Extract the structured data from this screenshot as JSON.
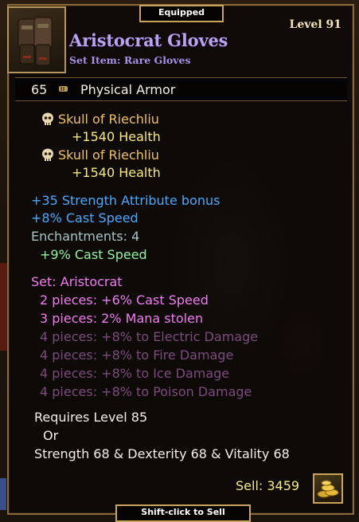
{
  "header": {
    "equipped_tab": "Equipped",
    "level": "Level 91",
    "item_name": "Aristocrat Gloves",
    "item_type": "Set Item: Rare Gloves",
    "item_icon": "gloves-icon"
  },
  "armor": {
    "value": "65",
    "label": "Physical Armor",
    "icon": "armor-fist-icon"
  },
  "sockets": [
    {
      "name": "Skull of Riechliu",
      "bonus": "+1540 Health",
      "icon": "skull-icon"
    },
    {
      "name": "Skull of Riechliu",
      "bonus": "+1540 Health",
      "icon": "skull-icon"
    }
  ],
  "attributes": [
    "+35 Strength Attribute bonus",
    "+8% Cast Speed"
  ],
  "enchantments": {
    "label": "Enchantments: 4",
    "items": [
      "+9% Cast Speed"
    ]
  },
  "set": {
    "name": "Set: Aristocrat",
    "bonuses_active": [
      "2 pieces: +6% Cast Speed",
      "3 pieces: 2% Mana stolen"
    ],
    "bonuses_inactive": [
      "4 pieces: +8% to Electric Damage",
      "4 pieces: +8% to Fire Damage",
      "4 pieces: +8% to Ice Damage",
      "4 pieces: +8% to Poison Damage"
    ]
  },
  "requirements": {
    "level": "Requires Level 85",
    "or": "Or",
    "stats": "Strength 68 & Dexterity 68 & Vitality 68"
  },
  "sell": {
    "label": "Sell: 3459",
    "icon": "gold-coins-icon"
  },
  "footer": {
    "hint": "Shift-click to Sell"
  },
  "colors": {
    "panel_border": "#8a6a3c",
    "title": "#b9a2f0",
    "socket_name": "#f0c060",
    "socket_bonus": "#f7e880",
    "attribute": "#4aa8ff",
    "enchant_label": "#a8c4c8",
    "enchant_value": "#96f0a0",
    "set_active": "#f07cf0",
    "set_inactive": "#7d4a7f"
  }
}
